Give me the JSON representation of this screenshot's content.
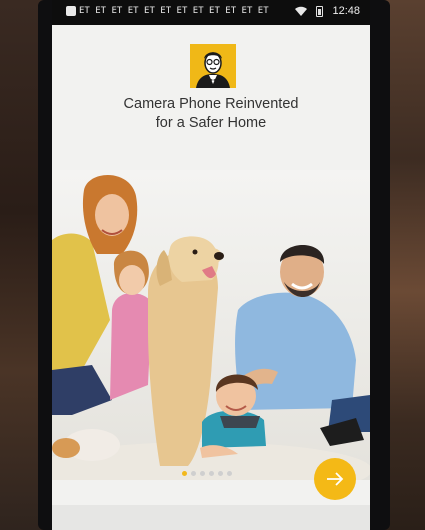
{
  "status_bar": {
    "notification_glyphs": "ET ET ET ET ET ET ET ET ET ET ET ET",
    "time": "12:48",
    "icons": [
      "app-icon",
      "wifi-icon",
      "battery-icon"
    ]
  },
  "onboarding": {
    "logo_icon": "butler-logo-icon",
    "headline_line1": "Camera Phone Reinvented",
    "headline_line2": "for a Safer Home",
    "hero_image": "family-with-dog-photo",
    "pager": {
      "total": 6,
      "active_index": 0
    },
    "next_icon": "arrow-right-icon",
    "accent_color": "#f2b81b"
  }
}
